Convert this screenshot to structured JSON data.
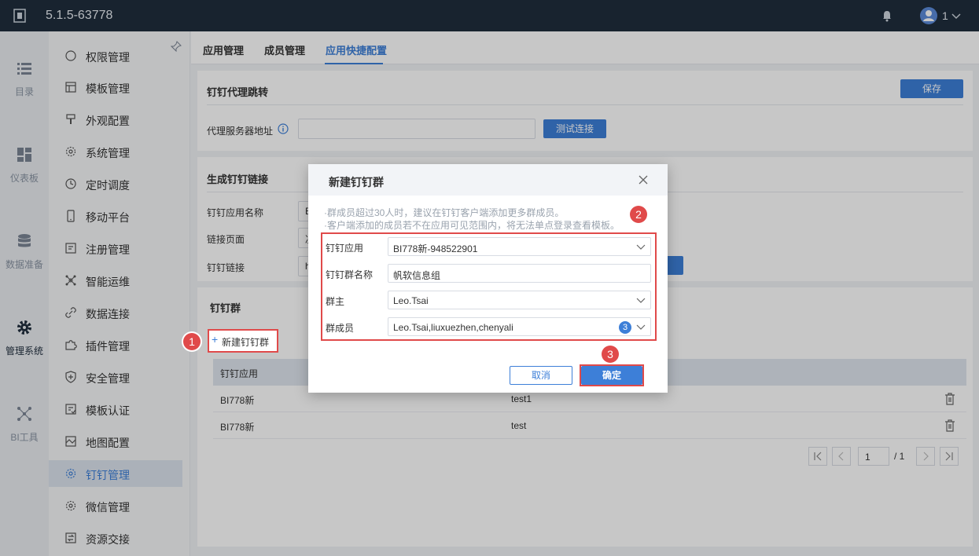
{
  "topbar": {
    "version": "5.1.5-63778",
    "user": "1"
  },
  "rail": [
    {
      "label": "目录",
      "icon": "list-icon"
    },
    {
      "label": "仪表板",
      "icon": "dashboard-icon"
    },
    {
      "label": "数据准备",
      "icon": "database-icon"
    },
    {
      "label": "管理系统",
      "icon": "gear-icon"
    },
    {
      "label": "BI工具",
      "icon": "network-icon"
    }
  ],
  "submenu": [
    {
      "label": "权限管理"
    },
    {
      "label": "模板管理"
    },
    {
      "label": "外观配置"
    },
    {
      "label": "系统管理"
    },
    {
      "label": "定时调度"
    },
    {
      "label": "移动平台"
    },
    {
      "label": "注册管理"
    },
    {
      "label": "智能运维"
    },
    {
      "label": "数据连接"
    },
    {
      "label": "插件管理"
    },
    {
      "label": "安全管理"
    },
    {
      "label": "模板认证"
    },
    {
      "label": "地图配置"
    },
    {
      "label": "钉钉管理"
    },
    {
      "label": "微信管理"
    },
    {
      "label": "资源交接"
    }
  ],
  "tabs": [
    {
      "label": "应用管理"
    },
    {
      "label": "成员管理"
    },
    {
      "label": "应用快捷配置"
    }
  ],
  "proxy": {
    "title": "钉钉代理跳转",
    "save": "保存",
    "server_label": "代理服务器地址",
    "test": "测试连接"
  },
  "link": {
    "title": "生成钉钉链接",
    "app_label": "钉钉应用名称",
    "app_value": "B",
    "page_label": "链接页面",
    "page_value": "决",
    "link_label": "钉钉链接",
    "link_value": "h"
  },
  "group": {
    "title": "钉钉群",
    "add": "新建钉钉群",
    "col_app": "钉钉应用",
    "rows": [
      {
        "app": "BI778新",
        "name": "test1"
      },
      {
        "app": "BI778新",
        "name": "test"
      }
    ],
    "page": "1",
    "total": "/ 1"
  },
  "dialog": {
    "title": "新建钉钉群",
    "hint1": "·群成员超过30人时，建议在钉钉客户端添加更多群成员。",
    "hint2": "·客户端添加的成员若不在应用可见范围内，将无法单点登录查看模板。",
    "fields": {
      "app_label": "钉钉应用",
      "app_value": "BI778新-948522901",
      "name_label": "钉钉群名称",
      "name_value": "帆软信息组",
      "owner_label": "群主",
      "owner_value": "Leo.Tsai",
      "members_label": "群成员",
      "members_value": "Leo.Tsai,liuxuezhen,chenyali",
      "members_count": "3"
    },
    "cancel": "取消",
    "ok": "确定"
  },
  "annotations": [
    "1",
    "2",
    "3"
  ],
  "colors": {
    "primary": "#3d7fd8",
    "topbar": "#1f2d3d",
    "annotation": "#e04a4a"
  }
}
